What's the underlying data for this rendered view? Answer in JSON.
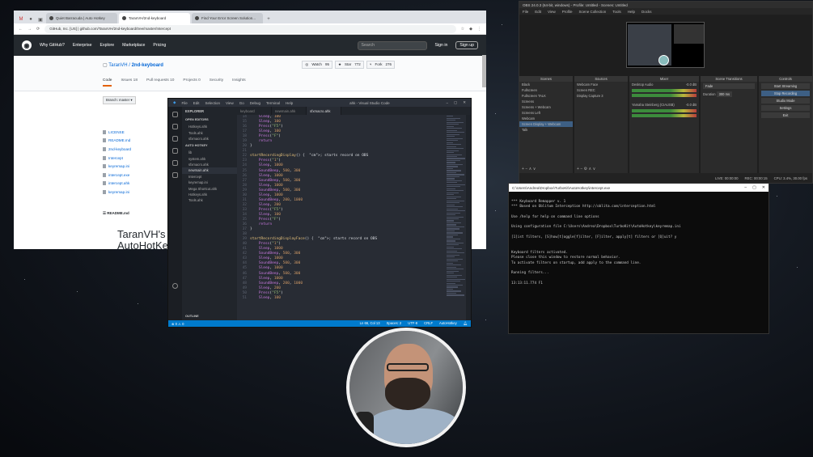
{
  "browser": {
    "tabs": [
      "Quiet Barracuda | Auto Hotkey",
      "TaranVH/2nd-keyboard",
      "Find Your Error Screen Solution..."
    ],
    "url": "GitHub, Inc. [US] | github.com/TaranVH/2nd-keyboard/tree/master/Intercept",
    "nav": [
      "Why GitHub?",
      "Enterprise",
      "Explore",
      "Marketplace",
      "Pricing"
    ],
    "search_placeholder": "Search",
    "sign_in": "Sign in",
    "sign_up": "Sign up",
    "repo_owner": "TaranVH",
    "repo_name": "2nd-keyboard",
    "watch_label": "Watch",
    "watch_count": "95",
    "star_label": "Star",
    "star_count": "772",
    "fork_label": "Fork",
    "fork_count": "276",
    "repo_tabs": [
      "Code",
      "Issues 18",
      "Pull requests 10",
      "Projects 0",
      "Security",
      "Insights"
    ],
    "branch": "Branch: master",
    "files": [
      "LICENSE",
      "README.md",
      "2nd-keyboard",
      "Intercept",
      "keyremap.ini",
      "intercept.exe",
      "intercept.ahk",
      "keyremap.ini"
    ],
    "readme_label": "README.md",
    "big_title": "TaranVH's i",
    "big_title2": "AutoHotKey"
  },
  "vscode": {
    "title": "ahk - Visual Studio Code",
    "menu": [
      "File",
      "Edit",
      "Selection",
      "View",
      "Go",
      "Debug",
      "Terminal",
      "Help"
    ],
    "tabs": [
      "keyboard",
      "newmain.ahk",
      "sfxmacro.ahk"
    ],
    "explorer_header": "EXPLORER",
    "open_editors": "OPEN EDITORS",
    "open_files": [
      "Hotkeys.ahk",
      "Tools.ahk",
      "sfxmacro.ahk"
    ],
    "folder": "AUTO HOTKEY",
    "tree": [
      "lib",
      "system.ahk",
      "sfxmacro.ahk",
      "newmain.ahk",
      "Intercept",
      "keyremap.ini",
      "Mega Shortcut.ahk",
      "Hotkeys.ahk",
      "Tools.ahk"
    ],
    "outline": "OUTLINE",
    "status_left": "⊗ 0 ⚠ 0",
    "status_items": [
      "Ln 66, Col 13",
      "Spaces: 2",
      "UTF-8",
      "CRLF",
      "AutoHotkey"
    ],
    "code": [
      {
        "n": "14",
        "t": "    Sleep, 100"
      },
      {
        "n": "15",
        "t": "    Sleep, 100"
      },
      {
        "n": "16",
        "t": "    Press(\"F5\")"
      },
      {
        "n": "17",
        "t": "    Sleep, 100"
      },
      {
        "n": "18",
        "t": "    Press(\"F\")"
      },
      {
        "n": "19",
        "t": "    return"
      },
      {
        "n": "20",
        "t": "}"
      },
      {
        "n": "21",
        "t": ""
      },
      {
        "n": "22",
        "t": "startRecordingDisplay() {  ; starts record on OBS"
      },
      {
        "n": "23",
        "t": "    Press(\"1\")"
      },
      {
        "n": "24",
        "t": "    Sleep, 1000"
      },
      {
        "n": "25",
        "t": "    SoundBeep, 500, 300"
      },
      {
        "n": "26",
        "t": "    Sleep, 1000"
      },
      {
        "n": "27",
        "t": "    SoundBeep, 500, 300"
      },
      {
        "n": "28",
        "t": "    Sleep, 1000"
      },
      {
        "n": "29",
        "t": "    SoundBeep, 500, 300"
      },
      {
        "n": "30",
        "t": "    Sleep, 1000"
      },
      {
        "n": "31",
        "t": "    SoundBeep, 200, 1000"
      },
      {
        "n": "32",
        "t": "    Sleep, 200"
      },
      {
        "n": "33",
        "t": "    Press(\"F5\")"
      },
      {
        "n": "34",
        "t": "    Sleep, 100"
      },
      {
        "n": "35",
        "t": "    Press(\"F\")"
      },
      {
        "n": "36",
        "t": "    return"
      },
      {
        "n": "37",
        "t": "}"
      },
      {
        "n": "38",
        "t": ""
      },
      {
        "n": "39",
        "t": "startRecordingDisplayFace() {  ; starts record on OBS"
      },
      {
        "n": "40",
        "t": "    Press(\"1\")"
      },
      {
        "n": "41",
        "t": "    Sleep, 1000"
      },
      {
        "n": "42",
        "t": "    SoundBeep, 500, 300"
      },
      {
        "n": "43",
        "t": "    Sleep, 1000"
      },
      {
        "n": "44",
        "t": "    SoundBeep, 500, 300"
      },
      {
        "n": "45",
        "t": "    Sleep, 1000"
      },
      {
        "n": "46",
        "t": "    SoundBeep, 500, 300"
      },
      {
        "n": "47",
        "t": "    Sleep, 1000"
      },
      {
        "n": "48",
        "t": "    SoundBeep, 200, 1000"
      },
      {
        "n": "49",
        "t": "    Sleep, 200"
      },
      {
        "n": "50",
        "t": "    Press(\"F5\")"
      },
      {
        "n": "51",
        "t": "    Sleep, 100"
      }
    ]
  },
  "obs": {
    "title": "OBS 24.0.3 (64-bit, windows) - Profile: Untitled - Scenes: Untitled",
    "menu": [
      "File",
      "Edit",
      "View",
      "Profile",
      "Scene Collection",
      "Tools",
      "Help",
      "Docks"
    ],
    "panels": [
      "Scenes",
      "Sources",
      "Mixer",
      "Scene Transitions",
      "Controls"
    ],
    "scenes": [
      "Black",
      "Fullscreen",
      "Fullscreen TALK",
      "Screens",
      "Screens + Webcam",
      "Screens Left",
      "Webcam",
      "Screen Display + Webcam",
      "Talk"
    ],
    "sources": [
      "Webcam Face",
      "Screen REC",
      "Display Capture 3"
    ],
    "mixer": [
      {
        "name": "Desktop Audio",
        "db": "-0.0 dB"
      },
      {
        "name": "Yamaha Steinberg (CIAUSB)",
        "db": "-0.0 dB"
      }
    ],
    "transition": "Fade",
    "duration_label": "Duration",
    "duration": "300 ms",
    "controls": [
      "Start Streaming",
      "Stop Recording",
      "Studio Mode",
      "Settings",
      "Exit"
    ],
    "status": [
      "LIVE: 00:00:00",
      "REC: 00:00:15",
      "CPU: 3.4%, 30.00 fps"
    ]
  },
  "terminal": {
    "title": "C:\\Users\\Andrea\\Dropbox\\TurboKit\\AutoHotkey\\intercept.exe",
    "lines": [
      "*** Keyboard Remapper v. 1",
      "*** Based on Oblitum Interception http://oblita.com/interception.html",
      "",
      "Use /help for help on command line options",
      "",
      "Using configuration file C:\\Users\\Andrea\\Dropbox\\TurboKit\\AutoHotkey\\keyremap.ini",
      "",
      "[1]ist filters, [S]how[t]oggle[f]ilter, [F]ilter, apply[t] filters or [Q]uit? y",
      "",
      "",
      "Keyboard filters activated.",
      "Please close this window to restore normal behavior.",
      "To activate filters on startup, add apply to the command line.",
      "",
      "Running filters...",
      "",
      "13:13:11.774 F1"
    ]
  }
}
